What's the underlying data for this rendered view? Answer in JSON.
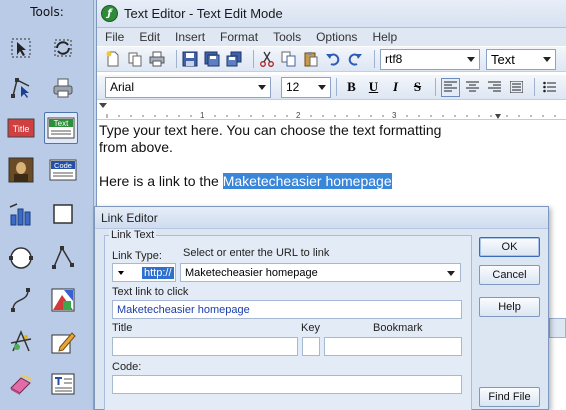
{
  "tools_panel": {
    "title": "Tools:",
    "items": [
      {
        "name": "select-arrow-icon"
      },
      {
        "name": "rotate-arrows-icon"
      },
      {
        "name": "node-edit-icon"
      },
      {
        "name": "printer-icon"
      },
      {
        "name": "title-text-icon",
        "text": "Title"
      },
      {
        "name": "text-box-icon",
        "text": "Text"
      },
      {
        "name": "picture-icon"
      },
      {
        "name": "code-icon",
        "text": "Code"
      },
      {
        "name": "chart-blocks-icon"
      },
      {
        "name": "rectangle-icon"
      },
      {
        "name": "circle-icon"
      },
      {
        "name": "angle-icon"
      },
      {
        "name": "curve-icon"
      },
      {
        "name": "color-square-icon"
      },
      {
        "name": "star-link-icon"
      },
      {
        "name": "pencil-edit-icon"
      },
      {
        "name": "eraser-icon"
      },
      {
        "name": "text-list-icon"
      }
    ]
  },
  "window": {
    "title": "Text Editor - Text Edit Mode"
  },
  "menu": [
    "File",
    "Edit",
    "Insert",
    "Format",
    "Tools",
    "Options",
    "Help"
  ],
  "toolbar": {
    "encoding": "rtf8",
    "mode": "Text",
    "font": "Arial",
    "size": "12",
    "bold": "B",
    "underline": "U",
    "italic": "I",
    "strike": "S"
  },
  "ruler": {
    "marks": [
      "1",
      "2",
      "3"
    ]
  },
  "document": {
    "line1": "Type your text here. You can choose the text formatting",
    "line2": "from above.",
    "line3_prefix": "Here is a link to the ",
    "link_text": "Maketecheasier homepage"
  },
  "dialog": {
    "title": "Link Editor",
    "group_label": "Link Text",
    "link_type_label": "Link Type:",
    "url_hint": "Select or enter the URL to link",
    "protocol": "http://",
    "url_value": "Maketecheasier homepage",
    "text_link_label": "Text link to click",
    "text_link_value": "Maketecheasier homepage",
    "title_label": "Title",
    "key_label": "Key",
    "bookmark_label": "Bookmark",
    "code_label": "Code:",
    "ok_label": "OK",
    "cancel_label": "Cancel",
    "help_label": "Help",
    "find_file_label": "Find File"
  }
}
